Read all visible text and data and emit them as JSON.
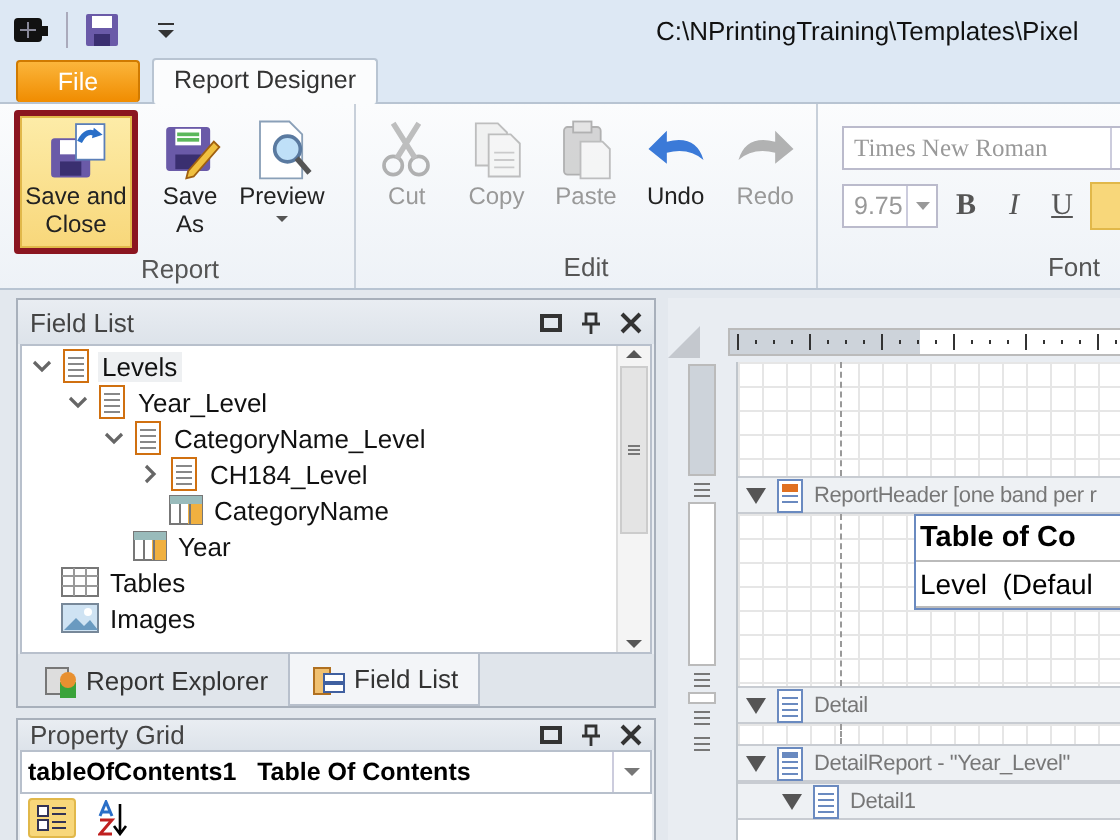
{
  "title_bar": {
    "path": "C:\\NPrintingTraining\\Templates\\Pixel"
  },
  "ribbon": {
    "tabs": [
      {
        "label": "File",
        "kind": "file",
        "selected": false
      },
      {
        "label": "Report Designer",
        "kind": "tab",
        "selected": true
      }
    ],
    "groups": [
      {
        "label": "Report",
        "buttons": [
          {
            "label": "Save and Close",
            "kind": "save-close",
            "highlighted": true,
            "disabled": false,
            "dropdown": false
          },
          {
            "label": "Save As",
            "kind": "save-as",
            "highlighted": false,
            "disabled": false,
            "dropdown": false
          },
          {
            "label": "Preview",
            "kind": "preview",
            "highlighted": false,
            "disabled": false,
            "dropdown": true
          }
        ]
      },
      {
        "label": "Edit",
        "buttons": [
          {
            "label": "Cut",
            "kind": "cut",
            "highlighted": false,
            "disabled": true,
            "dropdown": false
          },
          {
            "label": "Copy",
            "kind": "copy",
            "highlighted": false,
            "disabled": true,
            "dropdown": false
          },
          {
            "label": "Paste",
            "kind": "paste",
            "highlighted": false,
            "disabled": true,
            "dropdown": false
          },
          {
            "label": "Undo",
            "kind": "undo",
            "highlighted": false,
            "disabled": false,
            "dropdown": false
          },
          {
            "label": "Redo",
            "kind": "redo",
            "highlighted": false,
            "disabled": true,
            "dropdown": false
          }
        ]
      }
    ],
    "font_group": {
      "label": "Font",
      "font_name": "Times New Roman",
      "font_size": "9.75",
      "format_buttons": [
        {
          "label": "B",
          "kind": "bold"
        },
        {
          "label": "I",
          "kind": "italic"
        },
        {
          "label": "U",
          "kind": "underline"
        }
      ],
      "align_selected": true
    }
  },
  "field_list": {
    "title": "Field List",
    "tree": [
      {
        "label": "Levels",
        "kind": "level",
        "expanded": true,
        "selected": true,
        "children": [
          {
            "label": "Year_Level",
            "kind": "level",
            "expanded": true,
            "selected": false,
            "children": [
              {
                "label": "CategoryName_Level",
                "kind": "level",
                "expanded": true,
                "selected": false,
                "children": [
                  {
                    "label": "CH184_Level",
                    "kind": "level",
                    "expanded": false,
                    "selected": false
                  },
                  {
                    "label": "CategoryName",
                    "kind": "field",
                    "selected": false
                  }
                ]
              },
              {
                "label": "Year",
                "kind": "field",
                "selected": false
              }
            ]
          }
        ]
      },
      {
        "label": "Tables",
        "kind": "tables",
        "selected": false
      },
      {
        "label": "Images",
        "kind": "images",
        "selected": false
      }
    ],
    "tabs": [
      {
        "label": "Report Explorer",
        "kind": "explorer",
        "selected": false
      },
      {
        "label": "Field List",
        "kind": "fields",
        "selected": true
      }
    ]
  },
  "property_grid": {
    "title": "Property Grid",
    "object_name": "tableOfContents1",
    "object_type": "Table Of Contents",
    "categorized_selected": true
  },
  "design_surface": {
    "bands": [
      {
        "label": "ReportHeader [one band per r",
        "kind": "header",
        "nested": false,
        "content": [
          {
            "text": "Table of Co",
            "kind": "title"
          },
          {
            "text": "Level  (Defaul",
            "kind": "level"
          }
        ]
      },
      {
        "label": "Detail",
        "kind": "detail",
        "nested": false
      },
      {
        "label": "DetailReport - \"Year_Level\"",
        "kind": "detail-report",
        "nested": false
      },
      {
        "label": "Detail1",
        "kind": "detail",
        "nested": true
      }
    ]
  }
}
